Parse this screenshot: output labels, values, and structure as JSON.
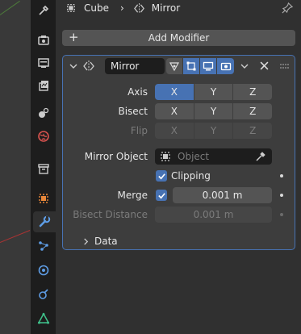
{
  "breadcrumb": {
    "object": "Cube",
    "separator": "›",
    "modifier": "Mirror"
  },
  "add_modifier_label": "Add Modifier",
  "modifier": {
    "name": "Mirror",
    "axis": {
      "label": "Axis",
      "options": [
        "X",
        "Y",
        "Z"
      ],
      "active": "X"
    },
    "bisect": {
      "label": "Bisect",
      "options": [
        "X",
        "Y",
        "Z"
      ]
    },
    "flip": {
      "label": "Flip",
      "options": [
        "X",
        "Y",
        "Z"
      ]
    },
    "mirror_object": {
      "label": "Mirror Object",
      "placeholder": "Object"
    },
    "clipping": {
      "label": "Clipping",
      "checked": true
    },
    "merge": {
      "label": "Merge",
      "checked": true,
      "value": "0.001 m"
    },
    "bisect_distance": {
      "label": "Bisect Distance",
      "value": "0.001 m"
    },
    "data_section": "Data"
  },
  "tabs": [
    "tool-icon",
    "render-icon",
    "output-icon",
    "view-layer-icon",
    "scene-icon",
    "world-icon",
    "collection-icon",
    "object-icon",
    "modifier-icon",
    "particles-icon",
    "physics-icon",
    "constraints-icon",
    "data-icon"
  ],
  "colors": {
    "accent": "#4772b3",
    "panel": "#3d3d3d",
    "background": "#303030"
  }
}
